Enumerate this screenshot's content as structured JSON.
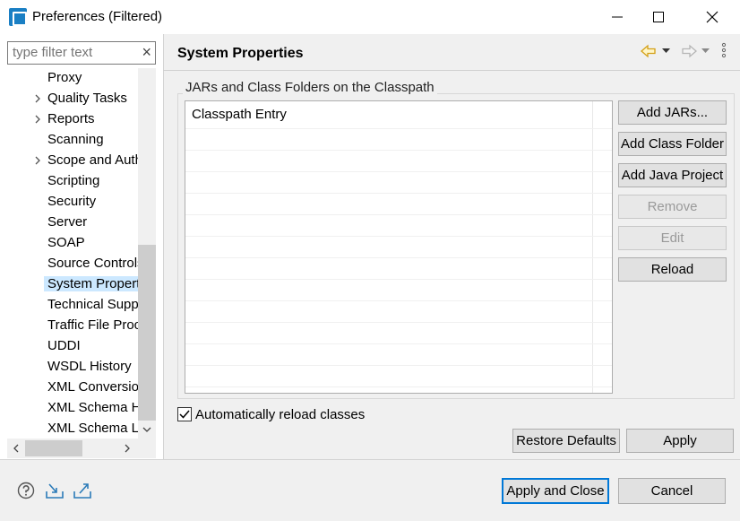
{
  "window": {
    "title": "Preferences (Filtered)"
  },
  "filter": {
    "placeholder": "type filter text",
    "clear_glyph": "×"
  },
  "tree": {
    "items": [
      {
        "label": "Proxy",
        "expandable": false,
        "selected": false
      },
      {
        "label": "Quality Tasks",
        "expandable": true,
        "selected": false
      },
      {
        "label": "Reports",
        "expandable": true,
        "selected": false
      },
      {
        "label": "Scanning",
        "expandable": false,
        "selected": false
      },
      {
        "label": "Scope and Auth",
        "expandable": true,
        "selected": false
      },
      {
        "label": "Scripting",
        "expandable": false,
        "selected": false
      },
      {
        "label": "Security",
        "expandable": false,
        "selected": false
      },
      {
        "label": "Server",
        "expandable": false,
        "selected": false
      },
      {
        "label": "SOAP",
        "expandable": false,
        "selected": false
      },
      {
        "label": "Source Controls",
        "expandable": false,
        "selected": false
      },
      {
        "label": "System Propert",
        "expandable": false,
        "selected": true
      },
      {
        "label": "Technical Supp",
        "expandable": false,
        "selected": false
      },
      {
        "label": "Traffic File Proc",
        "expandable": false,
        "selected": false
      },
      {
        "label": "UDDI",
        "expandable": false,
        "selected": false
      },
      {
        "label": "WSDL History",
        "expandable": false,
        "selected": false
      },
      {
        "label": "XML Conversion",
        "expandable": false,
        "selected": false
      },
      {
        "label": "XML Schema H",
        "expandable": false,
        "selected": false
      },
      {
        "label": "XML Schema Lo",
        "expandable": false,
        "selected": false
      }
    ]
  },
  "page": {
    "title": "System Properties",
    "group_label": "JARs and Class Folders on the Classpath",
    "table_header": "Classpath Entry"
  },
  "side_buttons": {
    "add_jars": "Add JARs...",
    "add_class_folder": "Add Class Folder",
    "add_java_project": "Add Java Project",
    "remove": "Remove",
    "edit": "Edit",
    "reload": "Reload"
  },
  "options": {
    "auto_reload_label": "Automatically reload classes",
    "auto_reload_checked": true
  },
  "page_buttons": {
    "restore_defaults": "Restore Defaults",
    "apply": "Apply"
  },
  "footer": {
    "apply_and_close": "Apply and Close",
    "cancel": "Cancel"
  },
  "colors": {
    "accent": "#0078d7",
    "selection": "#cce8ff",
    "nav_arrow": "#d4a017",
    "icon_blue": "#2a7ab8"
  }
}
